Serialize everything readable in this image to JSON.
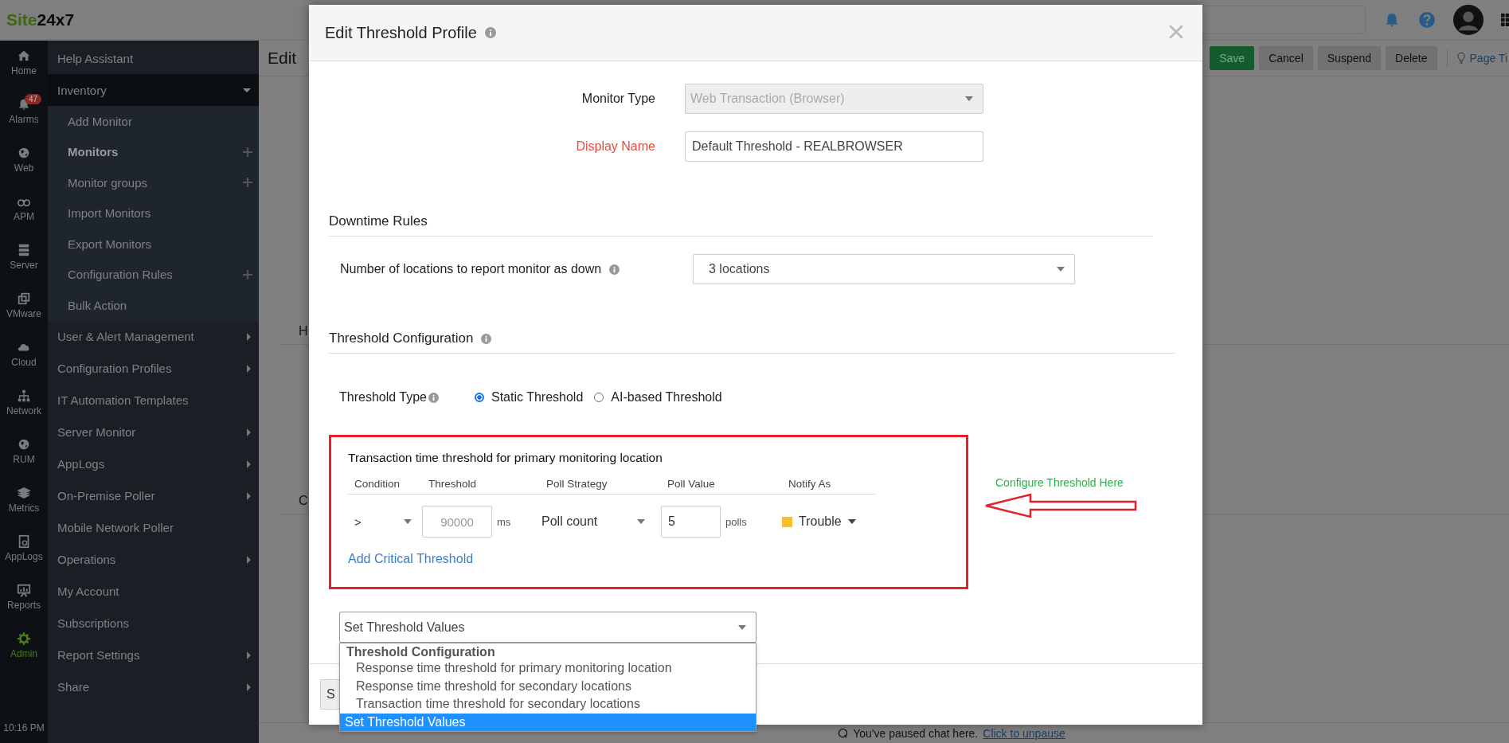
{
  "top_bar": {
    "logo_prefix": "Site",
    "logo_suffix": "24x7"
  },
  "icon_rail": [
    {
      "label": "Home",
      "selected": false
    },
    {
      "label": "Alarms",
      "selected": false,
      "badge": "47"
    },
    {
      "label": "Web",
      "selected": false
    },
    {
      "label": "APM",
      "selected": false
    },
    {
      "label": "Server",
      "selected": false
    },
    {
      "label": "VMware",
      "selected": false
    },
    {
      "label": "Cloud",
      "selected": false
    },
    {
      "label": "Network",
      "selected": false
    },
    {
      "label": "RUM",
      "selected": false
    },
    {
      "label": "Metrics",
      "selected": false
    },
    {
      "label": "AppLogs",
      "selected": false
    },
    {
      "label": "Reports",
      "selected": false
    },
    {
      "label": "Admin",
      "selected": true
    }
  ],
  "clock": "10:16 PM",
  "sidebar": {
    "items": [
      {
        "label": "Help Assistant",
        "submenu": false,
        "expanded": false
      },
      {
        "label": "Inventory",
        "submenu": true,
        "expanded": true,
        "children": [
          {
            "label": "Add Monitor",
            "selected": false,
            "addable": false
          },
          {
            "label": "Monitors",
            "selected": true,
            "addable": true
          },
          {
            "label": "Monitor groups",
            "selected": false,
            "addable": true
          },
          {
            "label": "Import Monitors",
            "selected": false,
            "addable": false
          },
          {
            "label": "Export Monitors",
            "selected": false,
            "addable": false
          },
          {
            "label": "Configuration Rules",
            "selected": false,
            "addable": true
          },
          {
            "label": "Bulk Action",
            "selected": false,
            "addable": false
          }
        ]
      },
      {
        "label": "User & Alert Management",
        "submenu": true,
        "expanded": false
      },
      {
        "label": "Configuration Profiles",
        "submenu": true,
        "expanded": false
      },
      {
        "label": "IT Automation Templates",
        "submenu": false,
        "expanded": false
      },
      {
        "label": "Server Monitor",
        "submenu": true,
        "expanded": false
      },
      {
        "label": "AppLogs",
        "submenu": true,
        "expanded": false
      },
      {
        "label": "On-Premise Poller",
        "submenu": true,
        "expanded": false
      },
      {
        "label": "Mobile Network Poller",
        "submenu": false,
        "expanded": false
      },
      {
        "label": "Operations",
        "submenu": true,
        "expanded": false
      },
      {
        "label": "My Account",
        "submenu": false,
        "expanded": false
      },
      {
        "label": "Subscriptions",
        "submenu": false,
        "expanded": false
      },
      {
        "label": "Report Settings",
        "submenu": true,
        "expanded": false
      },
      {
        "label": "Share",
        "submenu": true,
        "expanded": false
      }
    ]
  },
  "page": {
    "title": "Edit",
    "actions": [
      {
        "label": "Save",
        "kind": "primary"
      },
      {
        "label": "Cancel",
        "kind": "secondary"
      },
      {
        "label": "Suspend",
        "kind": "secondary"
      },
      {
        "label": "Delete",
        "kind": "secondary"
      }
    ],
    "page_tip": "Page Ti",
    "section_headings": [
      "H",
      "C"
    ]
  },
  "chat_notice": {
    "text": "You've paused chat here.",
    "link": "Click to unpause"
  },
  "modal": {
    "title": "Edit Threshold Profile",
    "monitor_type": {
      "label": "Monitor Type",
      "value": "Web Transaction (Browser)",
      "disabled": true
    },
    "display_name": {
      "label": "Display Name",
      "value": "Default Threshold - REALBROWSER",
      "required": true
    },
    "downtime_rules": {
      "heading": "Downtime Rules",
      "label": "Number of locations to report monitor as down",
      "value": "3 locations"
    },
    "threshold_configuration": {
      "heading": "Threshold Configuration",
      "type_label": "Threshold Type",
      "options": [
        {
          "label": "Static Threshold",
          "selected": true
        },
        {
          "label": "AI-based Threshold",
          "selected": false
        }
      ]
    },
    "threshold_box": {
      "title": "Transaction time threshold for primary monitoring location",
      "columns": [
        "Condition",
        "Threshold",
        "Poll Strategy",
        "Poll Value",
        "Notify As"
      ],
      "row": {
        "condition": ">",
        "threshold_placeholder": "90000",
        "threshold_unit": "ms",
        "poll_strategy": "Poll count",
        "poll_value": "5",
        "poll_unit": "polls",
        "notify_as": {
          "label": "Trouble",
          "color": "#f5c02c"
        }
      },
      "add_link": "Add Critical Threshold"
    },
    "annotation": "Configure Threshold Here",
    "section_select": {
      "value": "Set Threshold Values",
      "options": [
        {
          "label": "Threshold Configuration",
          "kind": "group",
          "selected": false
        },
        {
          "label": "Response time threshold for primary monitoring location",
          "kind": "option",
          "selected": false
        },
        {
          "label": "Response time threshold for secondary locations",
          "kind": "option",
          "selected": false
        },
        {
          "label": "Transaction time threshold for secondary locations",
          "kind": "option",
          "selected": false
        },
        {
          "label": "Set Threshold Values",
          "kind": "option",
          "selected": true
        }
      ]
    },
    "footer_button": "S"
  }
}
